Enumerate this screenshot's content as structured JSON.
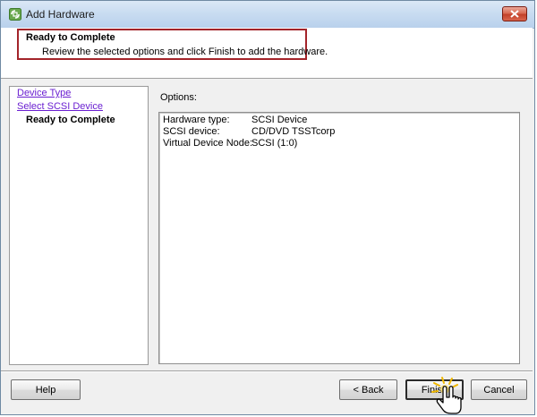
{
  "window": {
    "title": "Add Hardware",
    "icons": {
      "app": "vsphere-app-icon",
      "close": "close-icon"
    }
  },
  "header": {
    "title": "Ready to Complete",
    "subtitle": "Review the selected options and click Finish to add the hardware."
  },
  "sidebar": {
    "steps": [
      {
        "label": "Device Type",
        "state": "link"
      },
      {
        "label": "Select SCSI Device",
        "state": "link"
      },
      {
        "label": "Ready to Complete",
        "state": "current"
      }
    ]
  },
  "options": {
    "label": "Options:",
    "rows": [
      {
        "key": "Hardware type:",
        "value": "SCSI Device"
      },
      {
        "key": "SCSI device:",
        "value": "CD/DVD TSSTcorp"
      },
      {
        "key": "Virtual Device Node:",
        "value": "SCSI (1:0)"
      }
    ]
  },
  "buttons": {
    "help": "Help",
    "back": "< Back",
    "finish": "Finish",
    "cancel": "Cancel"
  },
  "colors": {
    "highlight_border": "#a3242a",
    "link": "#6a1fd1",
    "close_button": "#c2412a"
  },
  "cursor": {
    "icon": "hand-pointer-click-icon"
  }
}
